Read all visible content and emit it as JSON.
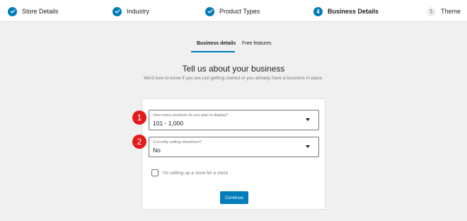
{
  "stepper": {
    "steps": [
      {
        "label": "Store Details",
        "state": "done",
        "icon": "check-icon"
      },
      {
        "label": "Industry",
        "state": "done",
        "icon": "check-icon"
      },
      {
        "label": "Product Types",
        "state": "done",
        "icon": "check-icon"
      },
      {
        "label": "Business Details",
        "state": "current",
        "number": "4"
      },
      {
        "label": "Theme",
        "state": "todo",
        "number": "5"
      }
    ]
  },
  "tabs": [
    {
      "label": "Business details",
      "active": true
    },
    {
      "label": "Free features",
      "active": false
    }
  ],
  "heading": {
    "title": "Tell us about your business",
    "subtitle": "We'd love to know if you are just getting started or you already have a business in place."
  },
  "form": {
    "products_field": {
      "label": "How many products do you plan to display?",
      "value": "101 - 1,000"
    },
    "selling_field": {
      "label": "Currently selling elsewhere?",
      "value": "No"
    },
    "client_checkbox": {
      "label": "I'm setting up a store for a client",
      "checked": false
    },
    "continue_label": "Continue"
  },
  "annotations": [
    {
      "label": "1"
    },
    {
      "label": "2"
    }
  ],
  "colors": {
    "accent": "#007cba",
    "badge": "#e31b1b",
    "background": "#f0f0f1"
  }
}
